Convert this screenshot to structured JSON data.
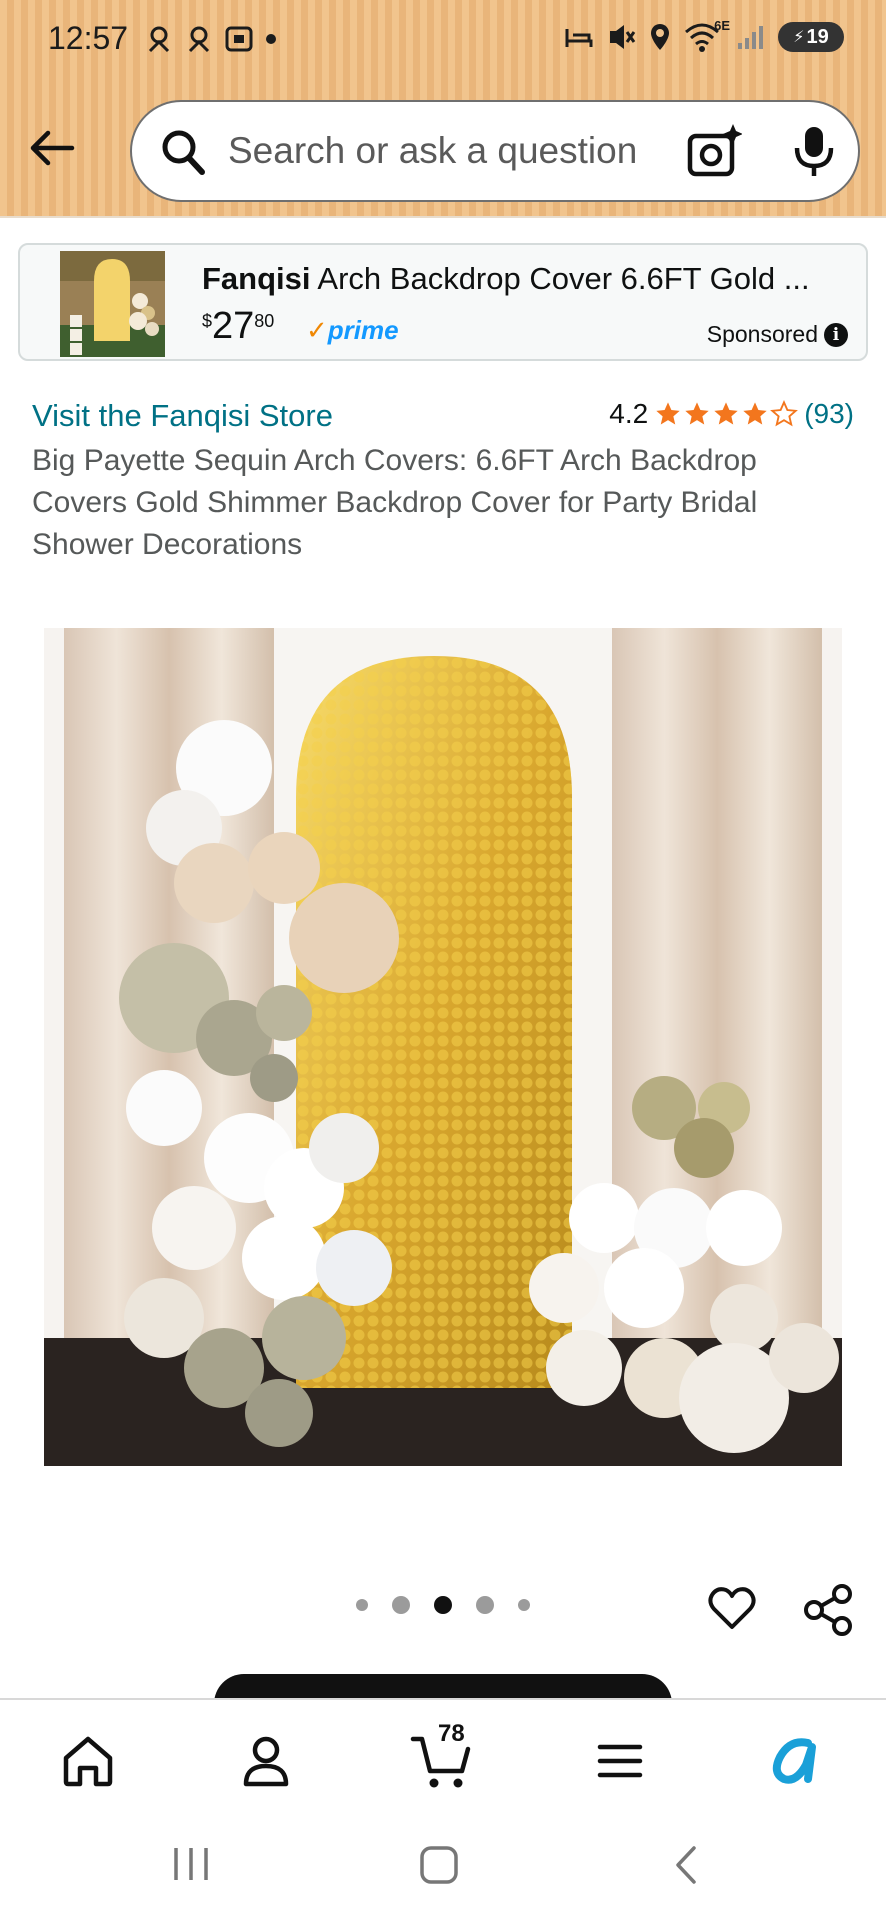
{
  "status_bar": {
    "time": "12:57",
    "network_label": "6E",
    "battery": "19"
  },
  "search": {
    "placeholder": "Search or ask a question"
  },
  "sponsored": {
    "brand": "Fanqisi",
    "title_rest": " Arch Backdrop Cover 6.6FT Gold ...",
    "price_currency": "$",
    "price_whole": "27",
    "price_fraction": "80",
    "prime_label": "prime",
    "sponsored_label": "Sponsored"
  },
  "product": {
    "store_link": "Visit the Fanqisi Store",
    "rating": "4.2",
    "stars": 4.2,
    "review_count": "(93)",
    "title": "Big Payette Sequin Arch Covers: 6.6FT Arch Backdrop Covers Gold Shimmer Backdrop Cover for Party Bridal Shower Decorations"
  },
  "carousel": {
    "image_count": 5,
    "active_index": 2
  },
  "bottom_nav": {
    "cart_count": "78"
  },
  "colors": {
    "header": "#f1c48d",
    "link": "#007185",
    "star": "#f3761d",
    "prime_blue": "#1399ff"
  }
}
